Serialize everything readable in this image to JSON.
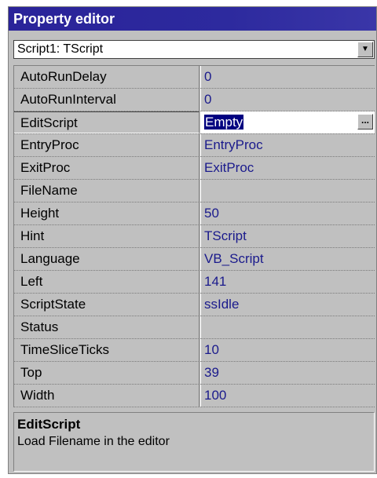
{
  "window": {
    "title": "Property editor"
  },
  "object_selector": {
    "selected": "Script1: TScript",
    "dropdown_icon": "chevron-down-icon"
  },
  "properties": [
    {
      "name": "AutoRunDelay",
      "value": "0"
    },
    {
      "name": "AutoRunInterval",
      "value": "0"
    },
    {
      "name": "EditScript",
      "value": "Empty",
      "selected": true
    },
    {
      "name": "EntryProc",
      "value": "EntryProc"
    },
    {
      "name": "ExitProc",
      "value": "ExitProc"
    },
    {
      "name": "FileName",
      "value": ""
    },
    {
      "name": "Height",
      "value": "50"
    },
    {
      "name": "Hint",
      "value": "TScript"
    },
    {
      "name": "Language",
      "value": "VB_Script"
    },
    {
      "name": "Left",
      "value": "141"
    },
    {
      "name": "ScriptState",
      "value": "ssIdle"
    },
    {
      "name": "Status",
      "value": ""
    },
    {
      "name": "TimeSliceTicks",
      "value": "10"
    },
    {
      "name": "Top",
      "value": "39"
    },
    {
      "name": "Width",
      "value": "100"
    }
  ],
  "ellipsis_button": {
    "label": "..."
  },
  "description": {
    "title": "EditScript",
    "text": "Load Filename in the editor"
  },
  "colors": {
    "titlebar": "#2a2399",
    "value_text": "#1a1a8c",
    "selection": "#000080",
    "panel": "#c0c0c0"
  }
}
